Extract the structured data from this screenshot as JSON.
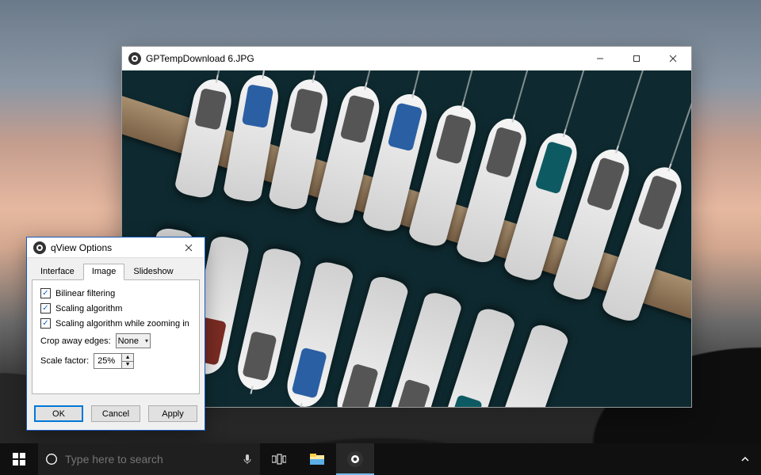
{
  "viewer": {
    "title": "GPTempDownload 6.JPG"
  },
  "options_dialog": {
    "title": "qView Options",
    "tabs": [
      "Interface",
      "Image",
      "Slideshow"
    ],
    "active_tab": "Image",
    "image_tab": {
      "bilinear_label": "Bilinear filtering",
      "bilinear_checked": true,
      "scaling_label": "Scaling algorithm",
      "scaling_checked": true,
      "scaling_zoom_label": "Scaling algorithm while zooming in",
      "scaling_zoom_checked": true,
      "crop_label": "Crop away edges:",
      "crop_value": "None",
      "scale_factor_label": "Scale factor:",
      "scale_factor_value": "25%"
    },
    "buttons": {
      "ok": "OK",
      "cancel": "Cancel",
      "apply": "Apply"
    }
  },
  "taskbar": {
    "search_placeholder": "Type here to search"
  }
}
